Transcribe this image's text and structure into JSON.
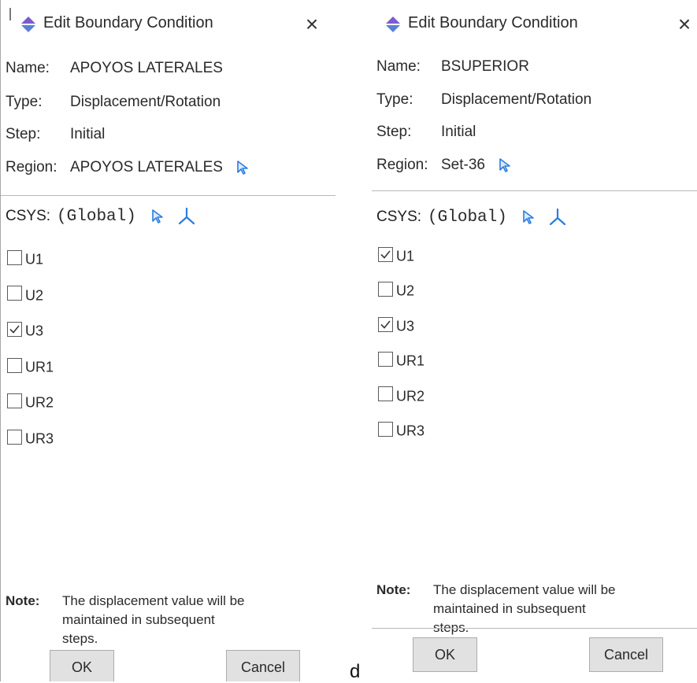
{
  "dialogs": [
    {
      "title": "Edit Boundary Condition",
      "name_label": "Name:",
      "name_value": "APOYOS LATERALES",
      "type_label": "Type:",
      "type_value": "Displacement/Rotation",
      "step_label": "Step:",
      "step_value": "Initial",
      "region_label": "Region:",
      "region_value": "APOYOS LATERALES",
      "csys_label": "CSYS:",
      "csys_value": "(Global)",
      "dofs": [
        {
          "label": "U1",
          "checked": false
        },
        {
          "label": "U2",
          "checked": false
        },
        {
          "label": "U3",
          "checked": true
        },
        {
          "label": "UR1",
          "checked": false
        },
        {
          "label": "UR2",
          "checked": false
        },
        {
          "label": "UR3",
          "checked": false
        }
      ],
      "note_label": "Note:",
      "note_text": "The displacement value will be maintained in subsequent steps.",
      "ok_label": "OK",
      "cancel_label": "Cancel"
    },
    {
      "title": "Edit Boundary Condition",
      "name_label": "Name:",
      "name_value": "BSUPERIOR",
      "type_label": "Type:",
      "type_value": "Displacement/Rotation",
      "step_label": "Step:",
      "step_value": "Initial",
      "region_label": "Region:",
      "region_value": "Set-36",
      "csys_label": "CSYS:",
      "csys_value": "(Global)",
      "dofs": [
        {
          "label": "U1",
          "checked": true
        },
        {
          "label": "U2",
          "checked": false
        },
        {
          "label": "U3",
          "checked": true
        },
        {
          "label": "UR1",
          "checked": false
        },
        {
          "label": "UR2",
          "checked": false
        },
        {
          "label": "UR3",
          "checked": false
        }
      ],
      "note_label": "Note:",
      "note_text": "The displacement value will be maintained in subsequent steps.",
      "ok_label": "OK",
      "cancel_label": "Cancel"
    }
  ],
  "stray_letter": "d",
  "colors": {
    "icon_blue": "#2b7de0",
    "title_icon_purple": "#7a5ccf"
  }
}
